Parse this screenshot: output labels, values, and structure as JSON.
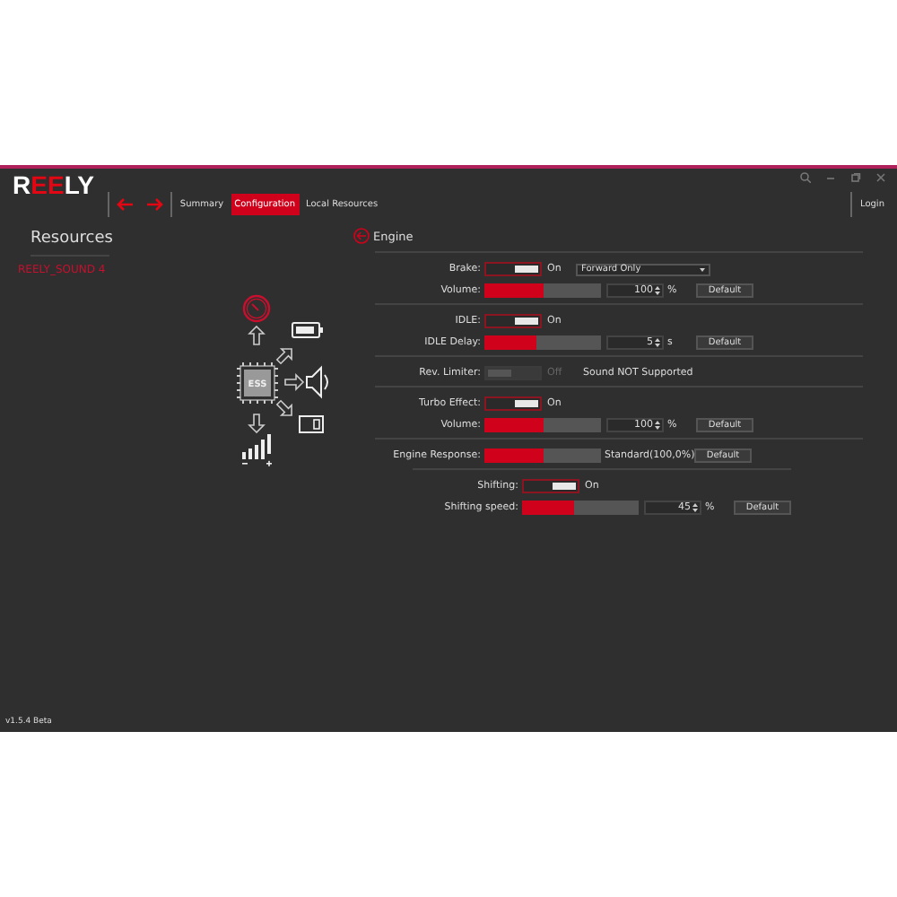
{
  "logo": [
    {
      "text": "R",
      "accent": false
    },
    {
      "text": "EE",
      "accent": true
    },
    {
      "text": "LY",
      "accent": false
    }
  ],
  "tabs": [
    {
      "label": "Summary",
      "selected": false
    },
    {
      "label": "Configuration",
      "selected": true
    },
    {
      "label": "Local Resources",
      "selected": false
    }
  ],
  "login": "Login",
  "sidebar": {
    "title": "Resources",
    "device": "REELY_SOUND 4",
    "chip_label": "ESS"
  },
  "version": "v1.5.4 Beta",
  "panel": {
    "title": "Engine",
    "groups": [
      [
        {
          "kind": "toggle",
          "label": "Brake:",
          "on": true,
          "disabled": false,
          "state_text": "On",
          "dropdown": "Forward Only"
        },
        {
          "kind": "slider",
          "label": "Volume:",
          "level": 0.5,
          "value": "100",
          "unit": "%",
          "button": "Default"
        }
      ],
      [
        {
          "kind": "toggle",
          "label": "IDLE:",
          "on": true,
          "disabled": false,
          "state_text": "On"
        },
        {
          "kind": "slider",
          "label": "IDLE Delay:",
          "level": 0.45,
          "value": "5",
          "unit": "s",
          "button": "Default"
        }
      ],
      [
        {
          "kind": "toggle",
          "label": "Rev. Limiter:",
          "on": false,
          "disabled": true,
          "state_text": "Off",
          "note": "Sound NOT Supported"
        }
      ],
      [
        {
          "kind": "toggle",
          "label": "Turbo Effect:",
          "on": true,
          "disabled": false,
          "state_text": "On"
        },
        {
          "kind": "slider",
          "label": "Volume:",
          "level": 0.5,
          "value": "100",
          "unit": "%",
          "button": "Default"
        }
      ],
      [
        {
          "kind": "response",
          "label": "Engine Response:",
          "level": 0.5,
          "reading": "Standard(100,0%)",
          "button": "Default"
        }
      ],
      [
        {
          "kind": "toggle",
          "label": "Shifting:",
          "on": true,
          "disabled": false,
          "state_text": "On"
        },
        {
          "kind": "slider",
          "label": "Shifting speed:",
          "level": 0.44,
          "value": "45",
          "unit": "%",
          "button": "Default"
        }
      ]
    ]
  }
}
